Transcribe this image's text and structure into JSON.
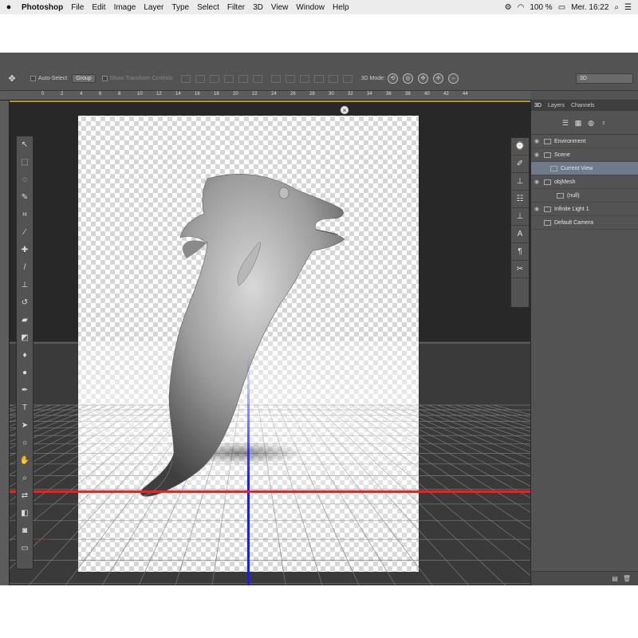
{
  "menubar": {
    "apple_icon": "apple-icon",
    "app_name": "Photoshop",
    "menus": [
      "File",
      "Edit",
      "Image",
      "Layer",
      "Type",
      "Select",
      "Filter",
      "3D",
      "View",
      "Window",
      "Help"
    ],
    "battery": "100 %",
    "datetime": "Mer. 16:22",
    "icons": [
      "creative-cloud-icon",
      "wifi-icon",
      "battery-icon",
      "search-icon",
      "list-icon"
    ]
  },
  "optionsbar": {
    "auto_select_label": "Auto-Select",
    "auto_select_value": "Group",
    "show_transform_label": "Show Transform Controls",
    "mode_label": "3D Mode:",
    "workspace_value": "3D"
  },
  "ruler": {
    "ticks": [
      "0",
      "2",
      "4",
      "6",
      "8",
      "10",
      "12",
      "14",
      "16",
      "18",
      "20",
      "22",
      "24",
      "26",
      "28",
      "30",
      "32",
      "34",
      "36",
      "38",
      "40",
      "42",
      "44"
    ]
  },
  "layers_panel": {
    "tabs": [
      "3D",
      "Layers",
      "Channels"
    ],
    "active_tab": "3D",
    "rows": [
      {
        "label": "Environment",
        "indent": 0,
        "visible": true,
        "selected": false
      },
      {
        "label": "Scene",
        "indent": 0,
        "visible": true,
        "selected": false
      },
      {
        "label": "Current View",
        "indent": 1,
        "visible": false,
        "selected": true
      },
      {
        "label": "objMesh",
        "indent": 0,
        "visible": true,
        "selected": false
      },
      {
        "label": "(null)",
        "indent": 2,
        "visible": false,
        "selected": false
      },
      {
        "label": "Infinite Light 1",
        "indent": 0,
        "visible": true,
        "selected": false
      },
      {
        "label": "Default Camera",
        "indent": 0,
        "visible": false,
        "selected": false
      }
    ]
  },
  "colors": {
    "selection": "#6d7b8c",
    "x_axis": "#ff1a1a",
    "y_axis": "#1a1aff",
    "guide": "#b89a2a"
  }
}
